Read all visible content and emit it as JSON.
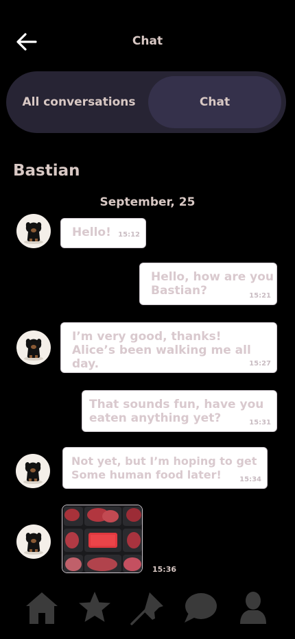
{
  "header": {
    "title": "Chat",
    "back_icon": "arrow-left-icon"
  },
  "tabs": [
    {
      "label": "All conversations",
      "active": false
    },
    {
      "label": "Chat",
      "active": true
    }
  ],
  "contact": {
    "name": "Bastian"
  },
  "date_label": "September, 25",
  "messages": [
    {
      "from": "Bastian",
      "text": "Hello!",
      "time": "15:12"
    },
    {
      "from": "me",
      "text": "Hello, how are you\nBastian?",
      "time": "15:21"
    },
    {
      "from": "Bastian",
      "text": "I’m very good, thanks!\nAlice’s been walking me all\nday.",
      "time": "15:27"
    },
    {
      "from": "me",
      "text": "That sounds fun, have you\neaten anything yet?",
      "time": "15:31"
    },
    {
      "from": "Bastian",
      "text": "Not yet, but I’m hoping to get\nSome human food later!",
      "time": "15:34"
    },
    {
      "from": "Bastian",
      "image": "raw-meat-tray-photo",
      "time": "15:36"
    }
  ],
  "nav": [
    {
      "icon": "home-icon"
    },
    {
      "icon": "star-icon"
    },
    {
      "icon": "pin-icon"
    },
    {
      "icon": "chat-bubble-icon",
      "active": true
    },
    {
      "icon": "user-icon"
    }
  ],
  "colors": {
    "background": "#000000",
    "segment_bg": "#272434",
    "segment_active": "#35314b",
    "text": "#d8c8c4",
    "icon_gray": "#3b3b3b"
  }
}
